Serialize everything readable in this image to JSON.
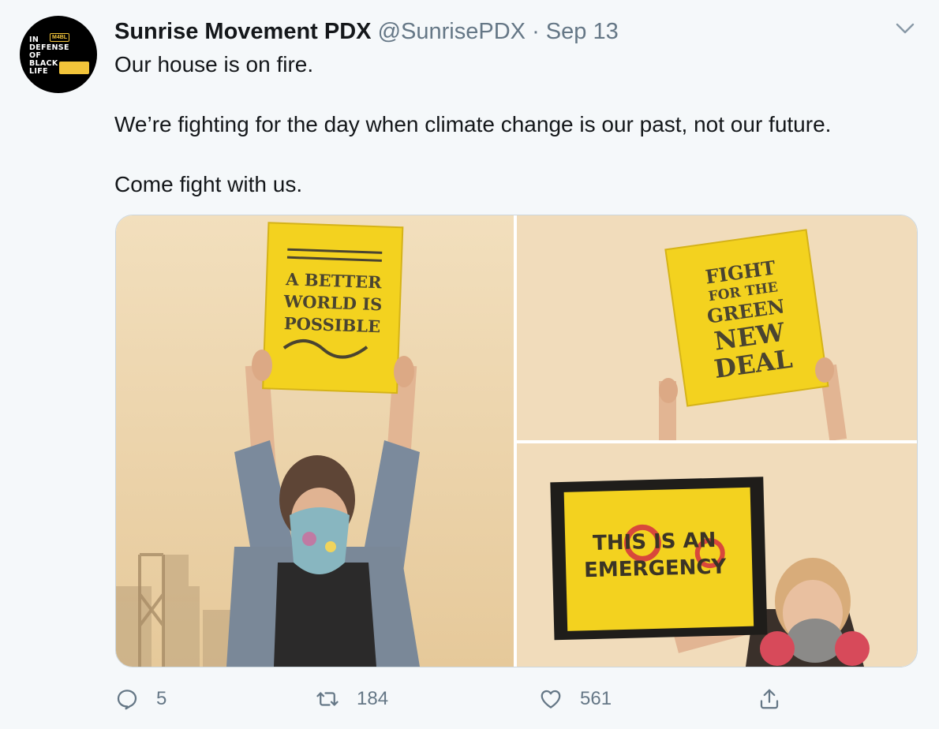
{
  "tweet": {
    "author_name": "Sunrise Movement PDX",
    "handle": "@SunrisePDX",
    "separator": "·",
    "date": "Sep 13",
    "text_lines": [
      "Our house is on fire.",
      "We’re fighting for the day when climate change is our past, not our future.",
      "Come fight with us."
    ]
  },
  "avatar": {
    "badge": "M4BL",
    "lines": [
      "IN",
      "DEFENSE",
      "OF",
      "BLACK",
      "LIFE"
    ]
  },
  "media": {
    "signs": [
      [
        "A BETTER",
        "WORLD IS",
        "POSSIBLE"
      ],
      [
        "FIGHT",
        "FOR THE",
        "GREEN",
        "NEW",
        "DEAL"
      ],
      [
        "THIS IS AN",
        "EMERGENCY"
      ]
    ]
  },
  "actions": {
    "reply_count": "5",
    "retweet_count": "184",
    "like_count": "561"
  },
  "colors": {
    "text_primary": "#14171a",
    "text_secondary": "#657786",
    "background": "#f5f8fa",
    "sign_yellow": "#f3d21f",
    "smoke_sky": "#efd9b4"
  },
  "icons": [
    "more-chevron-icon",
    "reply-icon",
    "retweet-icon",
    "like-icon",
    "share-icon"
  ]
}
